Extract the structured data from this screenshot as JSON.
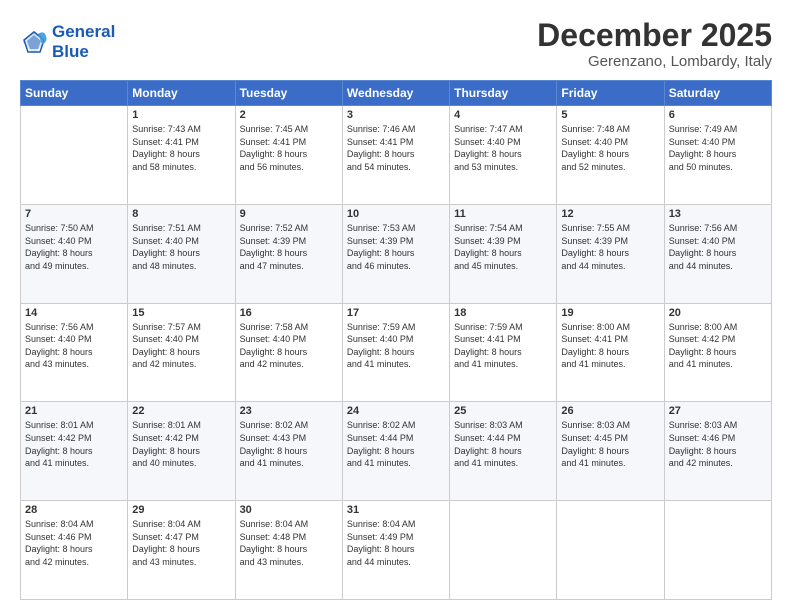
{
  "header": {
    "logo_line1": "General",
    "logo_line2": "Blue",
    "month": "December 2025",
    "location": "Gerenzano, Lombardy, Italy"
  },
  "weekdays": [
    "Sunday",
    "Monday",
    "Tuesday",
    "Wednesday",
    "Thursday",
    "Friday",
    "Saturday"
  ],
  "weeks": [
    [
      {
        "day": "",
        "info": ""
      },
      {
        "day": "1",
        "info": "Sunrise: 7:43 AM\nSunset: 4:41 PM\nDaylight: 8 hours\nand 58 minutes."
      },
      {
        "day": "2",
        "info": "Sunrise: 7:45 AM\nSunset: 4:41 PM\nDaylight: 8 hours\nand 56 minutes."
      },
      {
        "day": "3",
        "info": "Sunrise: 7:46 AM\nSunset: 4:41 PM\nDaylight: 8 hours\nand 54 minutes."
      },
      {
        "day": "4",
        "info": "Sunrise: 7:47 AM\nSunset: 4:40 PM\nDaylight: 8 hours\nand 53 minutes."
      },
      {
        "day": "5",
        "info": "Sunrise: 7:48 AM\nSunset: 4:40 PM\nDaylight: 8 hours\nand 52 minutes."
      },
      {
        "day": "6",
        "info": "Sunrise: 7:49 AM\nSunset: 4:40 PM\nDaylight: 8 hours\nand 50 minutes."
      }
    ],
    [
      {
        "day": "7",
        "info": "Sunrise: 7:50 AM\nSunset: 4:40 PM\nDaylight: 8 hours\nand 49 minutes."
      },
      {
        "day": "8",
        "info": "Sunrise: 7:51 AM\nSunset: 4:40 PM\nDaylight: 8 hours\nand 48 minutes."
      },
      {
        "day": "9",
        "info": "Sunrise: 7:52 AM\nSunset: 4:39 PM\nDaylight: 8 hours\nand 47 minutes."
      },
      {
        "day": "10",
        "info": "Sunrise: 7:53 AM\nSunset: 4:39 PM\nDaylight: 8 hours\nand 46 minutes."
      },
      {
        "day": "11",
        "info": "Sunrise: 7:54 AM\nSunset: 4:39 PM\nDaylight: 8 hours\nand 45 minutes."
      },
      {
        "day": "12",
        "info": "Sunrise: 7:55 AM\nSunset: 4:39 PM\nDaylight: 8 hours\nand 44 minutes."
      },
      {
        "day": "13",
        "info": "Sunrise: 7:56 AM\nSunset: 4:40 PM\nDaylight: 8 hours\nand 44 minutes."
      }
    ],
    [
      {
        "day": "14",
        "info": "Sunrise: 7:56 AM\nSunset: 4:40 PM\nDaylight: 8 hours\nand 43 minutes."
      },
      {
        "day": "15",
        "info": "Sunrise: 7:57 AM\nSunset: 4:40 PM\nDaylight: 8 hours\nand 42 minutes."
      },
      {
        "day": "16",
        "info": "Sunrise: 7:58 AM\nSunset: 4:40 PM\nDaylight: 8 hours\nand 42 minutes."
      },
      {
        "day": "17",
        "info": "Sunrise: 7:59 AM\nSunset: 4:40 PM\nDaylight: 8 hours\nand 41 minutes."
      },
      {
        "day": "18",
        "info": "Sunrise: 7:59 AM\nSunset: 4:41 PM\nDaylight: 8 hours\nand 41 minutes."
      },
      {
        "day": "19",
        "info": "Sunrise: 8:00 AM\nSunset: 4:41 PM\nDaylight: 8 hours\nand 41 minutes."
      },
      {
        "day": "20",
        "info": "Sunrise: 8:00 AM\nSunset: 4:42 PM\nDaylight: 8 hours\nand 41 minutes."
      }
    ],
    [
      {
        "day": "21",
        "info": "Sunrise: 8:01 AM\nSunset: 4:42 PM\nDaylight: 8 hours\nand 41 minutes."
      },
      {
        "day": "22",
        "info": "Sunrise: 8:01 AM\nSunset: 4:42 PM\nDaylight: 8 hours\nand 40 minutes."
      },
      {
        "day": "23",
        "info": "Sunrise: 8:02 AM\nSunset: 4:43 PM\nDaylight: 8 hours\nand 41 minutes."
      },
      {
        "day": "24",
        "info": "Sunrise: 8:02 AM\nSunset: 4:44 PM\nDaylight: 8 hours\nand 41 minutes."
      },
      {
        "day": "25",
        "info": "Sunrise: 8:03 AM\nSunset: 4:44 PM\nDaylight: 8 hours\nand 41 minutes."
      },
      {
        "day": "26",
        "info": "Sunrise: 8:03 AM\nSunset: 4:45 PM\nDaylight: 8 hours\nand 41 minutes."
      },
      {
        "day": "27",
        "info": "Sunrise: 8:03 AM\nSunset: 4:46 PM\nDaylight: 8 hours\nand 42 minutes."
      }
    ],
    [
      {
        "day": "28",
        "info": "Sunrise: 8:04 AM\nSunset: 4:46 PM\nDaylight: 8 hours\nand 42 minutes."
      },
      {
        "day": "29",
        "info": "Sunrise: 8:04 AM\nSunset: 4:47 PM\nDaylight: 8 hours\nand 43 minutes."
      },
      {
        "day": "30",
        "info": "Sunrise: 8:04 AM\nSunset: 4:48 PM\nDaylight: 8 hours\nand 43 minutes."
      },
      {
        "day": "31",
        "info": "Sunrise: 8:04 AM\nSunset: 4:49 PM\nDaylight: 8 hours\nand 44 minutes."
      },
      {
        "day": "",
        "info": ""
      },
      {
        "day": "",
        "info": ""
      },
      {
        "day": "",
        "info": ""
      }
    ]
  ]
}
